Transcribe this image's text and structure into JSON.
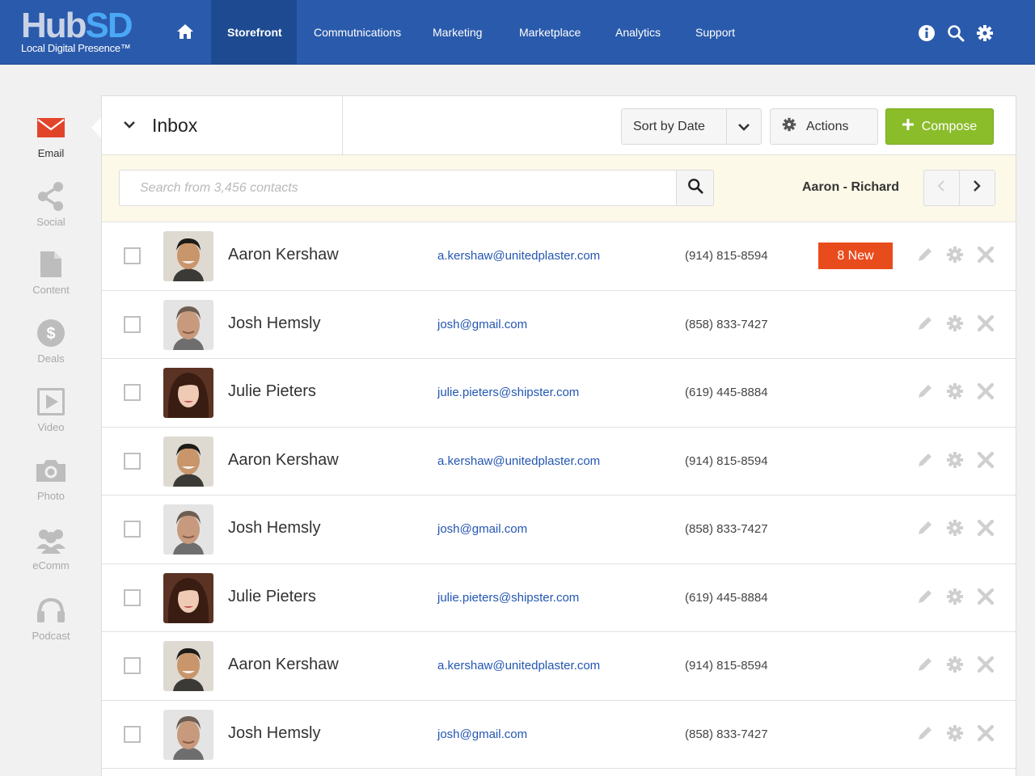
{
  "brand": {
    "logo_main_a": "Hub",
    "logo_main_b": "SD",
    "logo_sub": "Local Digital Presence™"
  },
  "nav": {
    "home_icon": "home-icon",
    "items": [
      {
        "label": "Storefront",
        "active": true
      },
      {
        "label": "Commutnications",
        "active": false
      },
      {
        "label": "Marketing",
        "active": false
      },
      {
        "label": "Marketplace",
        "active": false
      },
      {
        "label": "Analytics",
        "active": false
      },
      {
        "label": "Support",
        "active": false
      }
    ],
    "right_icons": [
      "info-icon",
      "search-icon",
      "gear-icon"
    ]
  },
  "sidebar": {
    "items": [
      {
        "label": "Email",
        "icon": "envelope-icon",
        "active": true
      },
      {
        "label": "Social",
        "icon": "share-icon",
        "active": false
      },
      {
        "label": "Content",
        "icon": "document-icon",
        "active": false
      },
      {
        "label": "Deals",
        "icon": "dollar-icon",
        "active": false
      },
      {
        "label": "Video",
        "icon": "play-icon",
        "active": false
      },
      {
        "label": "Photo",
        "icon": "camera-icon",
        "active": false
      },
      {
        "label": "eComm",
        "icon": "people-icon",
        "active": false
      },
      {
        "label": "Podcast",
        "icon": "headphones-icon",
        "active": false
      }
    ]
  },
  "header": {
    "title": "Inbox",
    "sort_label": "Sort by Date",
    "actions_label": "Actions",
    "compose_label": "Compose"
  },
  "search": {
    "placeholder": "Search from 3,456 contacts",
    "value": "",
    "range_label": "Aaron - Richard"
  },
  "contacts": [
    {
      "name": "Aaron Kershaw",
      "email": "a.kershaw@unitedplaster.com",
      "phone": "(914) 815-8594",
      "badge": "8 New",
      "avatar": "aaron"
    },
    {
      "name": "Josh Hemsly",
      "email": "josh@gmail.com",
      "phone": "(858) 833-7427",
      "badge": "",
      "avatar": "josh"
    },
    {
      "name": "Julie Pieters",
      "email": "julie.pieters@shipster.com",
      "phone": "(619) 445-8884",
      "badge": "",
      "avatar": "julie"
    },
    {
      "name": "Aaron Kershaw",
      "email": "a.kershaw@unitedplaster.com",
      "phone": "(914) 815-8594",
      "badge": "",
      "avatar": "aaron"
    },
    {
      "name": "Josh Hemsly",
      "email": "josh@gmail.com",
      "phone": "(858) 833-7427",
      "badge": "",
      "avatar": "josh"
    },
    {
      "name": "Julie Pieters",
      "email": "julie.pieters@shipster.com",
      "phone": "(619) 445-8884",
      "badge": "",
      "avatar": "julie"
    },
    {
      "name": "Aaron Kershaw",
      "email": "a.kershaw@unitedplaster.com",
      "phone": "(914) 815-8594",
      "badge": "",
      "avatar": "aaron"
    },
    {
      "name": "Josh Hemsly",
      "email": "josh@gmail.com",
      "phone": "(858) 833-7427",
      "badge": "",
      "avatar": "josh"
    }
  ],
  "colors": {
    "nav_bg": "#2a5aab",
    "nav_active": "#1d4a91",
    "accent_green": "#8bbd2b",
    "badge_red": "#e94c1c",
    "email_link": "#2356b2"
  }
}
